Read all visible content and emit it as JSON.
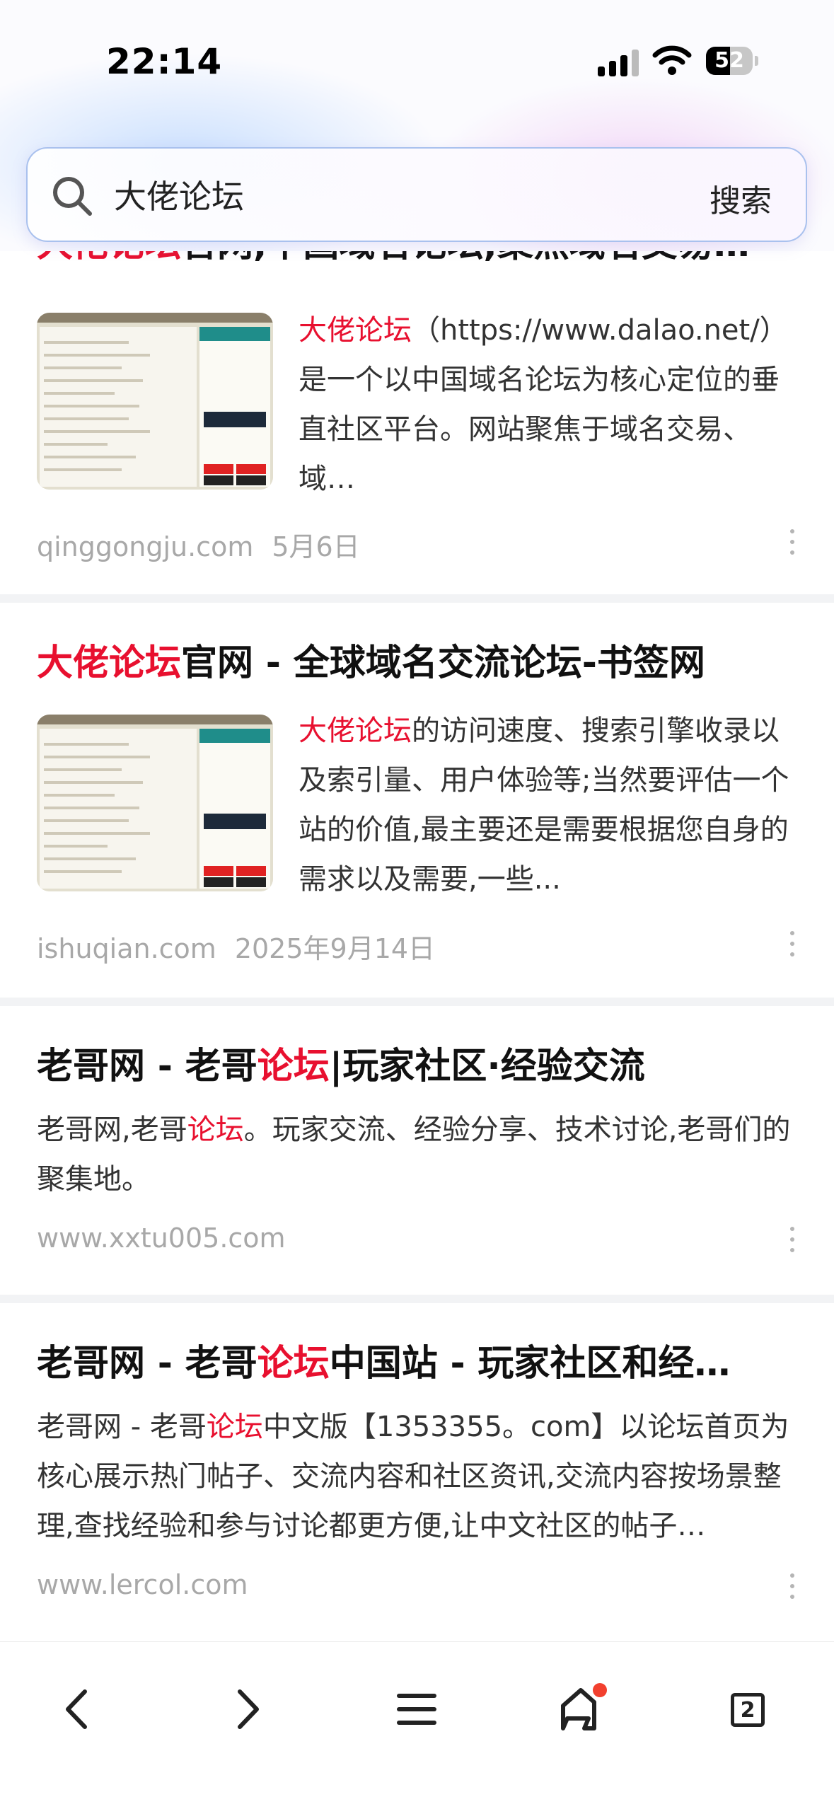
{
  "status_bar": {
    "time": "22:14",
    "battery": "52",
    "battery_level": 0.52
  },
  "search": {
    "query": "大佬论坛",
    "button_label": "搜索"
  },
  "results": [
    {
      "title_parts": [
        {
          "text": "大佬论坛",
          "hl": true
        },
        {
          "text": "官网,中国域名论坛,聚焦域名交易…",
          "hl": false
        }
      ],
      "snippet_parts": [
        {
          "text": "大佬论坛",
          "hl": true
        },
        {
          "text": "（https://www.dalao.net/）是一个以中国域名论坛为核心定位的垂直社区平台。网站聚焦于域名交易、域…",
          "hl": false
        }
      ],
      "source": "qinggongju.com",
      "date": "5月6日",
      "has_thumbnail": true
    },
    {
      "title_parts": [
        {
          "text": "大佬论坛",
          "hl": true
        },
        {
          "text": "官网 - 全球域名交流论坛-书签网",
          "hl": false
        }
      ],
      "snippet_parts": [
        {
          "text": "大佬论坛",
          "hl": true
        },
        {
          "text": "的访问速度、搜索引擎收录以及索引量、用户体验等;当然要评估一个站的价值,最主要还是需要根据您自身的需求以及需要,一些...",
          "hl": false
        }
      ],
      "source": "ishuqian.com",
      "date": "2025年9月14日",
      "has_thumbnail": true
    },
    {
      "title_parts": [
        {
          "text": "老哥网 - 老哥",
          "hl": false
        },
        {
          "text": "论坛",
          "hl": true
        },
        {
          "text": "|玩家社区·经验交流",
          "hl": false
        }
      ],
      "snippet_parts": [
        {
          "text": "老哥网,老哥",
          "hl": false
        },
        {
          "text": "论坛",
          "hl": true
        },
        {
          "text": "。玩家交流、经验分享、技术讨论,老哥们的聚集地。",
          "hl": false
        }
      ],
      "source": "www.xxtu005.com",
      "date": "",
      "has_thumbnail": false
    },
    {
      "title_parts": [
        {
          "text": "老哥网 - 老哥",
          "hl": false
        },
        {
          "text": "论坛",
          "hl": true
        },
        {
          "text": "中国站 - 玩家社区和经…",
          "hl": false
        }
      ],
      "snippet_parts": [
        {
          "text": "老哥网 - 老哥",
          "hl": false
        },
        {
          "text": "论坛",
          "hl": true
        },
        {
          "text": "中文版【1353355。com】以论坛首页为核心展示热门帖子、交流内容和社区资讯,交流内容按场景整理,查找经验和参与讨论都更方便,让中文社区的帖子…",
          "hl": false
        }
      ],
      "source": "www.lercol.com",
      "date": "",
      "has_thumbnail": false
    }
  ],
  "bottom_nav": {
    "items": [
      "back-icon",
      "forward-icon",
      "menu-icon",
      "home-icon",
      "tabs-icon"
    ],
    "tabs_count": "2",
    "notification_color": "#f2402e"
  },
  "colors": {
    "highlight": "#e8102f",
    "meta": "#a8a8a8",
    "separator": "#f2f3f5"
  }
}
